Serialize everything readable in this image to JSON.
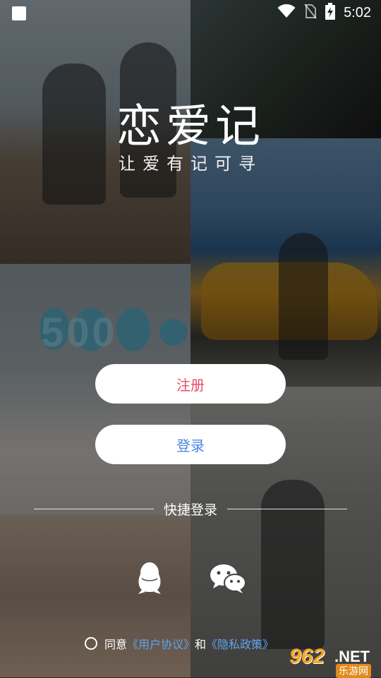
{
  "status_bar": {
    "time": "5:02",
    "icons": [
      "app-square-icon",
      "wifi-icon",
      "no-sim-icon",
      "battery-charging-icon"
    ]
  },
  "app": {
    "title": "恋爱记",
    "slogan": "让爱有记可寻"
  },
  "actions": {
    "register_label": "注册",
    "login_label": "登录",
    "register_color": "#e94d6a",
    "login_color": "#4a86e0"
  },
  "quick_login": {
    "label": "快捷登录",
    "providers": [
      "qq-icon",
      "wechat-icon"
    ]
  },
  "agreement": {
    "prefix": "同意",
    "user_agreement": "《用户协议》",
    "conjunction": "和",
    "privacy_policy": "《隐私政策》",
    "link_color": "#5fa3f0"
  },
  "watermark": {
    "number": "962",
    "suffix": ".NET",
    "cn": "乐游网"
  },
  "background_photo_text": "500"
}
